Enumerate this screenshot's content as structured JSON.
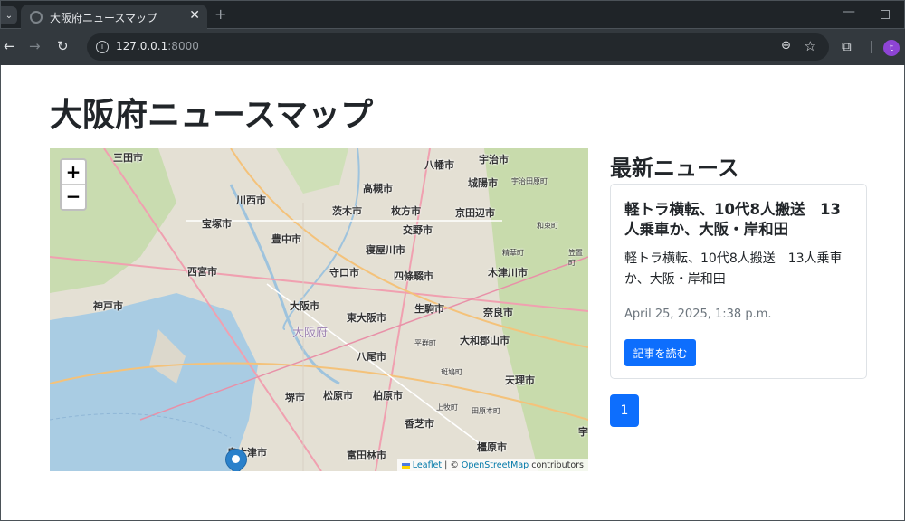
{
  "browser": {
    "tab_title": "大阪府ニュースマップ",
    "url_host": "127.0.0.1",
    "url_port": ":8000",
    "avatar_letter": "t"
  },
  "page": {
    "title": "大阪府ニュースマップ"
  },
  "map": {
    "zoom_in": "+",
    "zoom_out": "−",
    "attribution_leaflet": "Leaflet",
    "attribution_sep": " | © ",
    "attribution_osm": "OpenStreetMap",
    "attribution_tail": " contributors",
    "labels": [
      "三田市",
      "八幡市",
      "宇治市",
      "城陽市",
      "川西市",
      "高槻市",
      "茨木市",
      "枚方市",
      "京田辺市",
      "宝塚市",
      "交野市",
      "豊中市",
      "寝屋川市",
      "西宮市",
      "守口市",
      "四條畷市",
      "木津川市",
      "神戸市",
      "大阪市",
      "生駒市",
      "奈良市",
      "東大阪市",
      "大和郡山市",
      "八尾市",
      "天理市",
      "堺市",
      "松原市",
      "柏原市",
      "香芝市",
      "泉大津市",
      "富田林市",
      "橿原市",
      "大阪府",
      "宇治田原町",
      "和束町",
      "笠置町",
      "精華町",
      "平群町",
      "斑鳩町",
      "上牧町",
      "田原本町",
      "宇"
    ]
  },
  "news": {
    "heading": "最新ニュース",
    "items": [
      {
        "title": "軽トラ横転、10代8人搬送　13人乗車か、大阪・岸和田",
        "summary": "軽トラ横転、10代8人搬送　13人乗車か、大阪・岸和田",
        "date": "April 25, 2025, 1:38 p.m.",
        "button": "記事を読む"
      }
    ],
    "page_number": "1"
  }
}
